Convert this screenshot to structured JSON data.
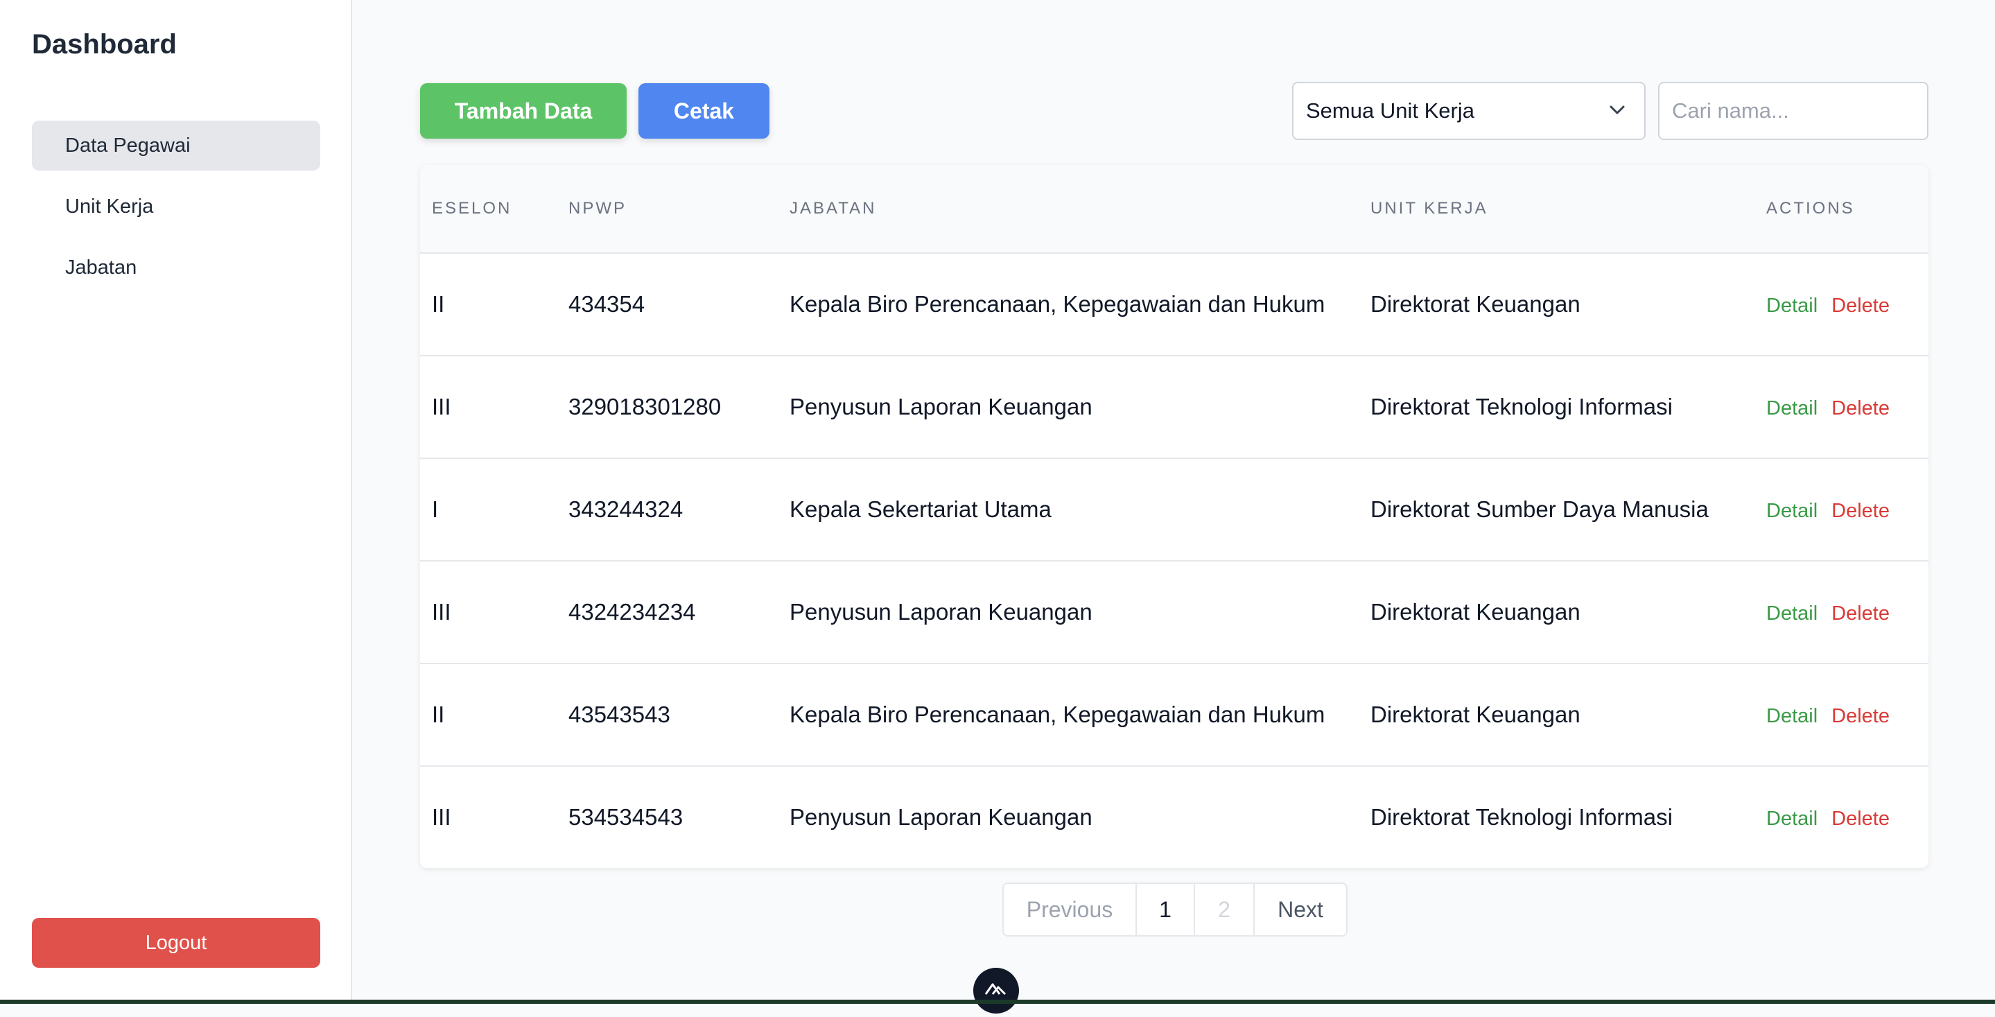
{
  "sidebar": {
    "brand": "Dashboard",
    "items": [
      {
        "label": "Data Pegawai",
        "active": true
      },
      {
        "label": "Unit Kerja",
        "active": false
      },
      {
        "label": "Jabatan",
        "active": false
      }
    ],
    "logout_label": "Logout"
  },
  "toolbar": {
    "add_label": "Tambah Data",
    "print_label": "Cetak",
    "unit_filter_value": "Semua Unit Kerja",
    "search_placeholder": "Cari nama...",
    "search_value": ""
  },
  "table": {
    "headers": [
      "ESELON",
      "NPWP",
      "JABATAN",
      "UNIT KERJA",
      "ACTIONS"
    ],
    "detail_label": "Detail",
    "delete_label": "Delete",
    "rows": [
      {
        "eselon": "II",
        "npwp": "434354",
        "jabatan": "Kepala Biro Perencanaan, Kepegawaian dan Hukum",
        "unit_kerja": "Direktorat Keuangan"
      },
      {
        "eselon": "III",
        "npwp": "329018301280",
        "jabatan": "Penyusun Laporan Keuangan",
        "unit_kerja": "Direktorat Teknologi Informasi"
      },
      {
        "eselon": "I",
        "npwp": "343244324",
        "jabatan": "Kepala Sekertariat Utama",
        "unit_kerja": "Direktorat Sumber Daya Manusia"
      },
      {
        "eselon": "III",
        "npwp": "4324234234",
        "jabatan": "Penyusun Laporan Keuangan",
        "unit_kerja": "Direktorat Keuangan"
      },
      {
        "eselon": "II",
        "npwp": "43543543",
        "jabatan": "Kepala Biro Perencanaan, Kepegawaian dan Hukum",
        "unit_kerja": "Direktorat Keuangan"
      },
      {
        "eselon": "III",
        "npwp": "534534543",
        "jabatan": "Penyusun Laporan Keuangan",
        "unit_kerja": "Direktorat Teknologi Informasi"
      }
    ]
  },
  "pagination": {
    "previous_label": "Previous",
    "pages": [
      "1",
      "2"
    ],
    "current_page": "1",
    "next_label": "Next"
  },
  "colors": {
    "add_button": "#5cc466",
    "print_button": "#4f86f0",
    "logout_button": "#e0514b",
    "detail_link": "#3a9a46",
    "delete_link": "#d93a36"
  },
  "icons": {
    "select_chevron": "chevron-down-icon",
    "dev_badge": "devtools-logo-icon"
  }
}
